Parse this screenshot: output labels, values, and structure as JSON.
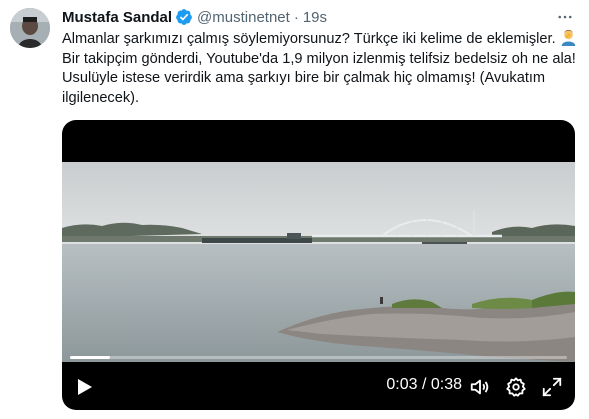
{
  "author": {
    "name": "Mustafa Sandal",
    "handle": "@mustinetnet",
    "separator": "·",
    "time": "19s",
    "verified": true,
    "verified_color": "#1d9bf0"
  },
  "tweet": {
    "text_part1": "Almanlar şarkımızı çalmış söylemiyorsunuz?  Türkçe iki kelime de eklemişler. ",
    "emoji": "man-facepalming-emoji",
    "text_part2": " Bir takipçim gönderdi, Youtube'da 1,9 milyon izlenmiş telifsiz bedelsiz oh ne ala! Usulüyle istese verirdik ama şarkıyı bire bir çalmak hiç olmamış! (Avukatım ilgilenecek)."
  },
  "video": {
    "current_time": "0:03",
    "time_separator": " / ",
    "duration": "0:38",
    "progress_fraction": 0.08,
    "icons": [
      "play-icon",
      "volume-icon",
      "settings-icon",
      "fullscreen-icon"
    ]
  },
  "menu": {
    "icon": "more-icon"
  }
}
